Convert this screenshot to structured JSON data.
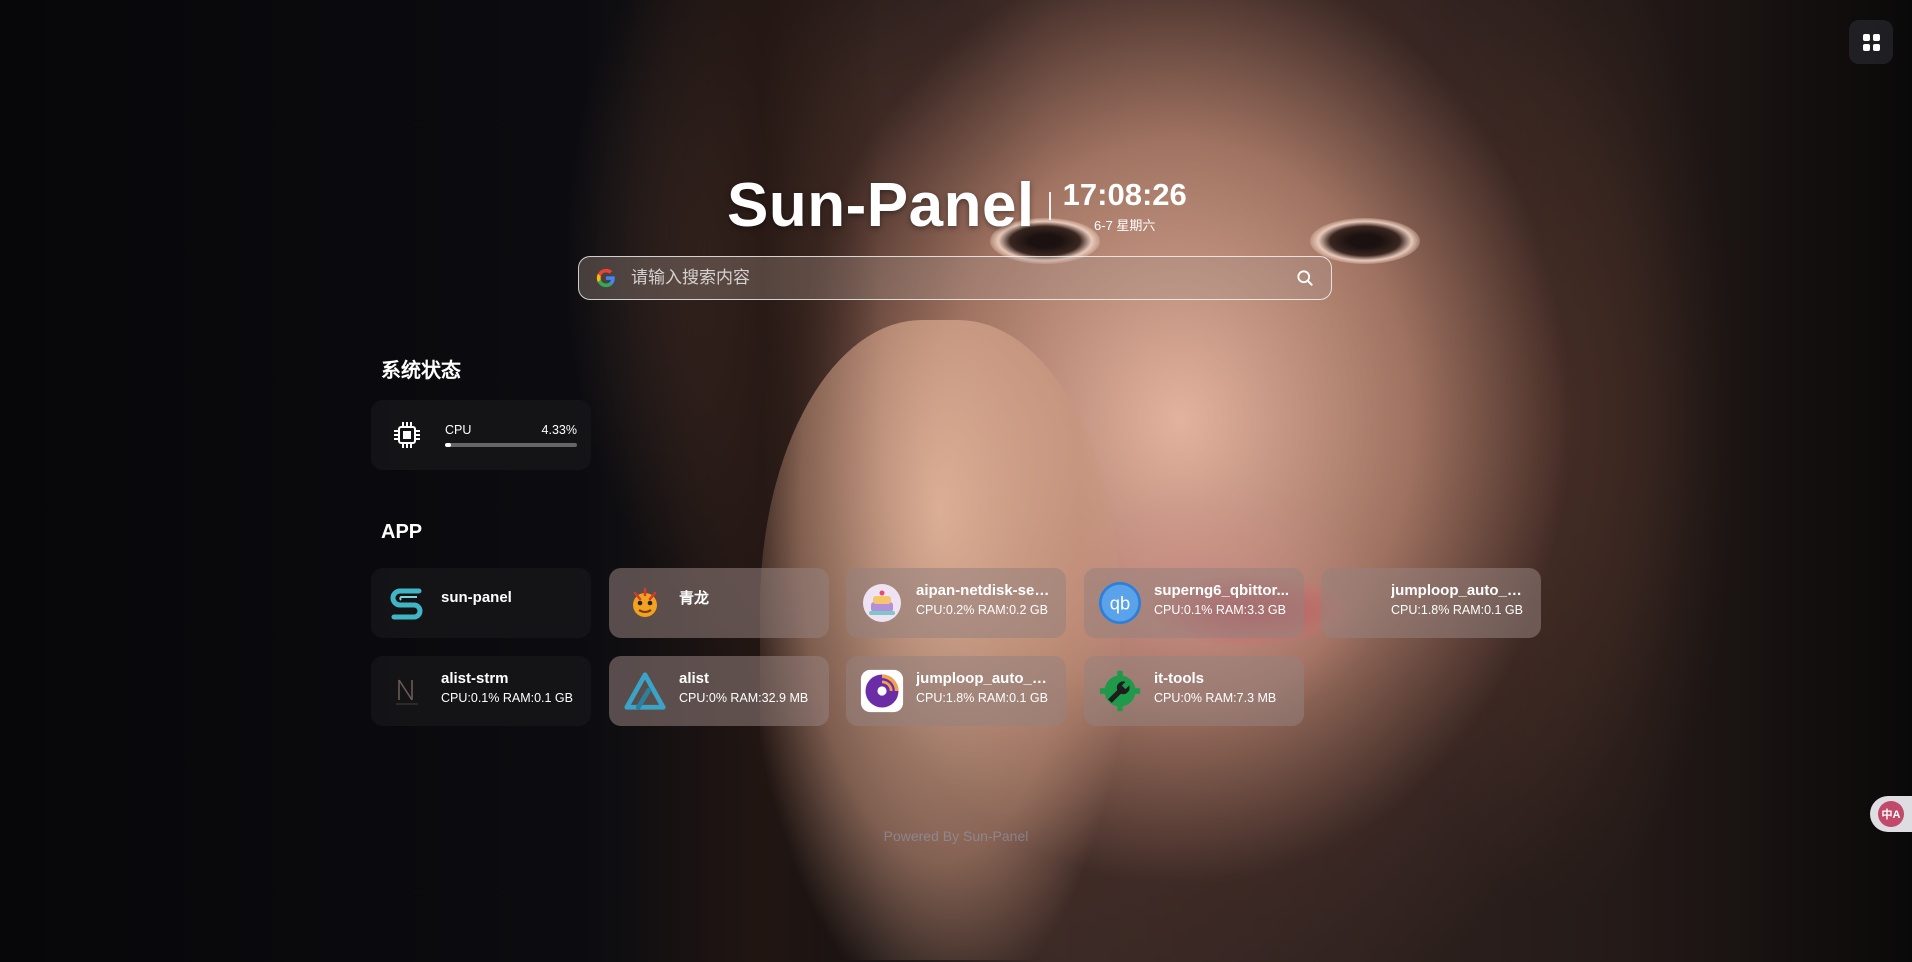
{
  "header": {
    "brand": "Sun-Panel",
    "time": "17:08:26",
    "date": "6-7 星期六"
  },
  "search": {
    "placeholder": "请输入搜索内容",
    "engine_icon": "google-icon",
    "submit_icon": "search-icon"
  },
  "system_status": {
    "title": "系统状态",
    "cpu": {
      "label": "CPU",
      "value_text": "4.33%",
      "percent": 4.33,
      "icon": "cpu-chip-icon"
    }
  },
  "apps": {
    "title": "APP",
    "items": [
      {
        "name": "sun-panel",
        "stat": "",
        "icon": "sun-panel-logo-icon"
      },
      {
        "name": "青龙",
        "stat": "",
        "icon": "qinglong-dragon-icon"
      },
      {
        "name": "aipan-netdisk-sea...",
        "stat": "CPU:0.2% RAM:0.2 GB",
        "icon": "aipan-cake-icon"
      },
      {
        "name": "superng6_qbittor...",
        "stat": "CPU:0.1% RAM:3.3 GB",
        "icon": "qbittorrent-icon"
      },
      {
        "name": "jumploop_auto_b...",
        "stat": "CPU:1.8% RAM:0.1 GB",
        "icon": "blank-app-icon"
      },
      {
        "name": "alist-strm",
        "stat": "CPU:0.1% RAM:0.1 GB",
        "icon": "alist-strm-logo-icon"
      },
      {
        "name": "alist",
        "stat": "CPU:0% RAM:32.9 MB",
        "icon": "alist-triangle-icon"
      },
      {
        "name": "jumploop_auto_b...",
        "stat": "CPU:1.8% RAM:0.1 GB",
        "icon": "rss-disc-icon"
      },
      {
        "name": "it-tools",
        "stat": "CPU:0% RAM:7.3 MB",
        "icon": "wrench-gear-icon"
      }
    ]
  },
  "footer": {
    "text": "Powered By Sun-Panel"
  },
  "toolbar": {
    "menu_icon": "grid-menu-icon",
    "translate_icon": "translate-icon"
  },
  "colors": {
    "card_dark": "#16161a",
    "accent_qb": "#2f7fd8",
    "cpu_bar": "#ffffff"
  }
}
